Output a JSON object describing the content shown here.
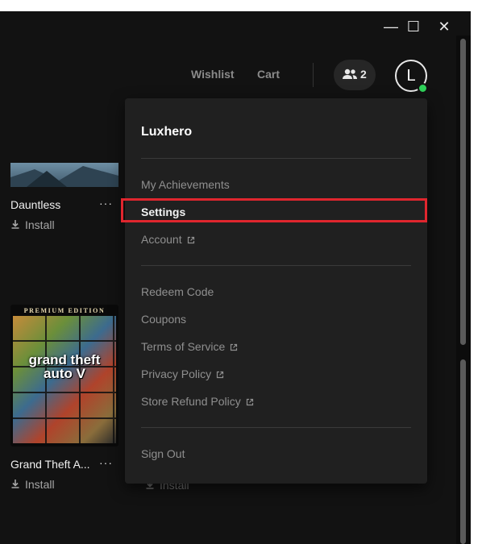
{
  "window": {
    "minimize": "—",
    "maximize": "☐",
    "close": "✕"
  },
  "nav": {
    "wishlist": "Wishlist",
    "cart": "Cart",
    "friends_count": "2",
    "avatar_initial": "L"
  },
  "library": {
    "games": [
      {
        "title": "Dauntless",
        "more": "···",
        "action": "Install"
      },
      {
        "title": "Grand Theft A...",
        "more": "···",
        "action": "Install",
        "cover_edition": "PREMIUM EDITION",
        "cover_logo": "grand theft auto V"
      }
    ],
    "partial_action": "Install"
  },
  "menu": {
    "username": "Luxhero",
    "items": [
      {
        "label": "My Achievements",
        "external": false
      },
      {
        "label": "Settings",
        "external": false,
        "highlighted": true
      },
      {
        "label": "Account",
        "external": true
      }
    ],
    "items2": [
      {
        "label": "Redeem Code",
        "external": false
      },
      {
        "label": "Coupons",
        "external": false
      },
      {
        "label": "Terms of Service",
        "external": true
      },
      {
        "label": "Privacy Policy",
        "external": true
      },
      {
        "label": "Store Refund Policy",
        "external": true
      }
    ],
    "sign_out": "Sign Out"
  },
  "colors": {
    "accent_highlight": "#e0262e",
    "online": "#2fd25a",
    "menu_bg": "#202020",
    "app_bg": "#121212"
  }
}
